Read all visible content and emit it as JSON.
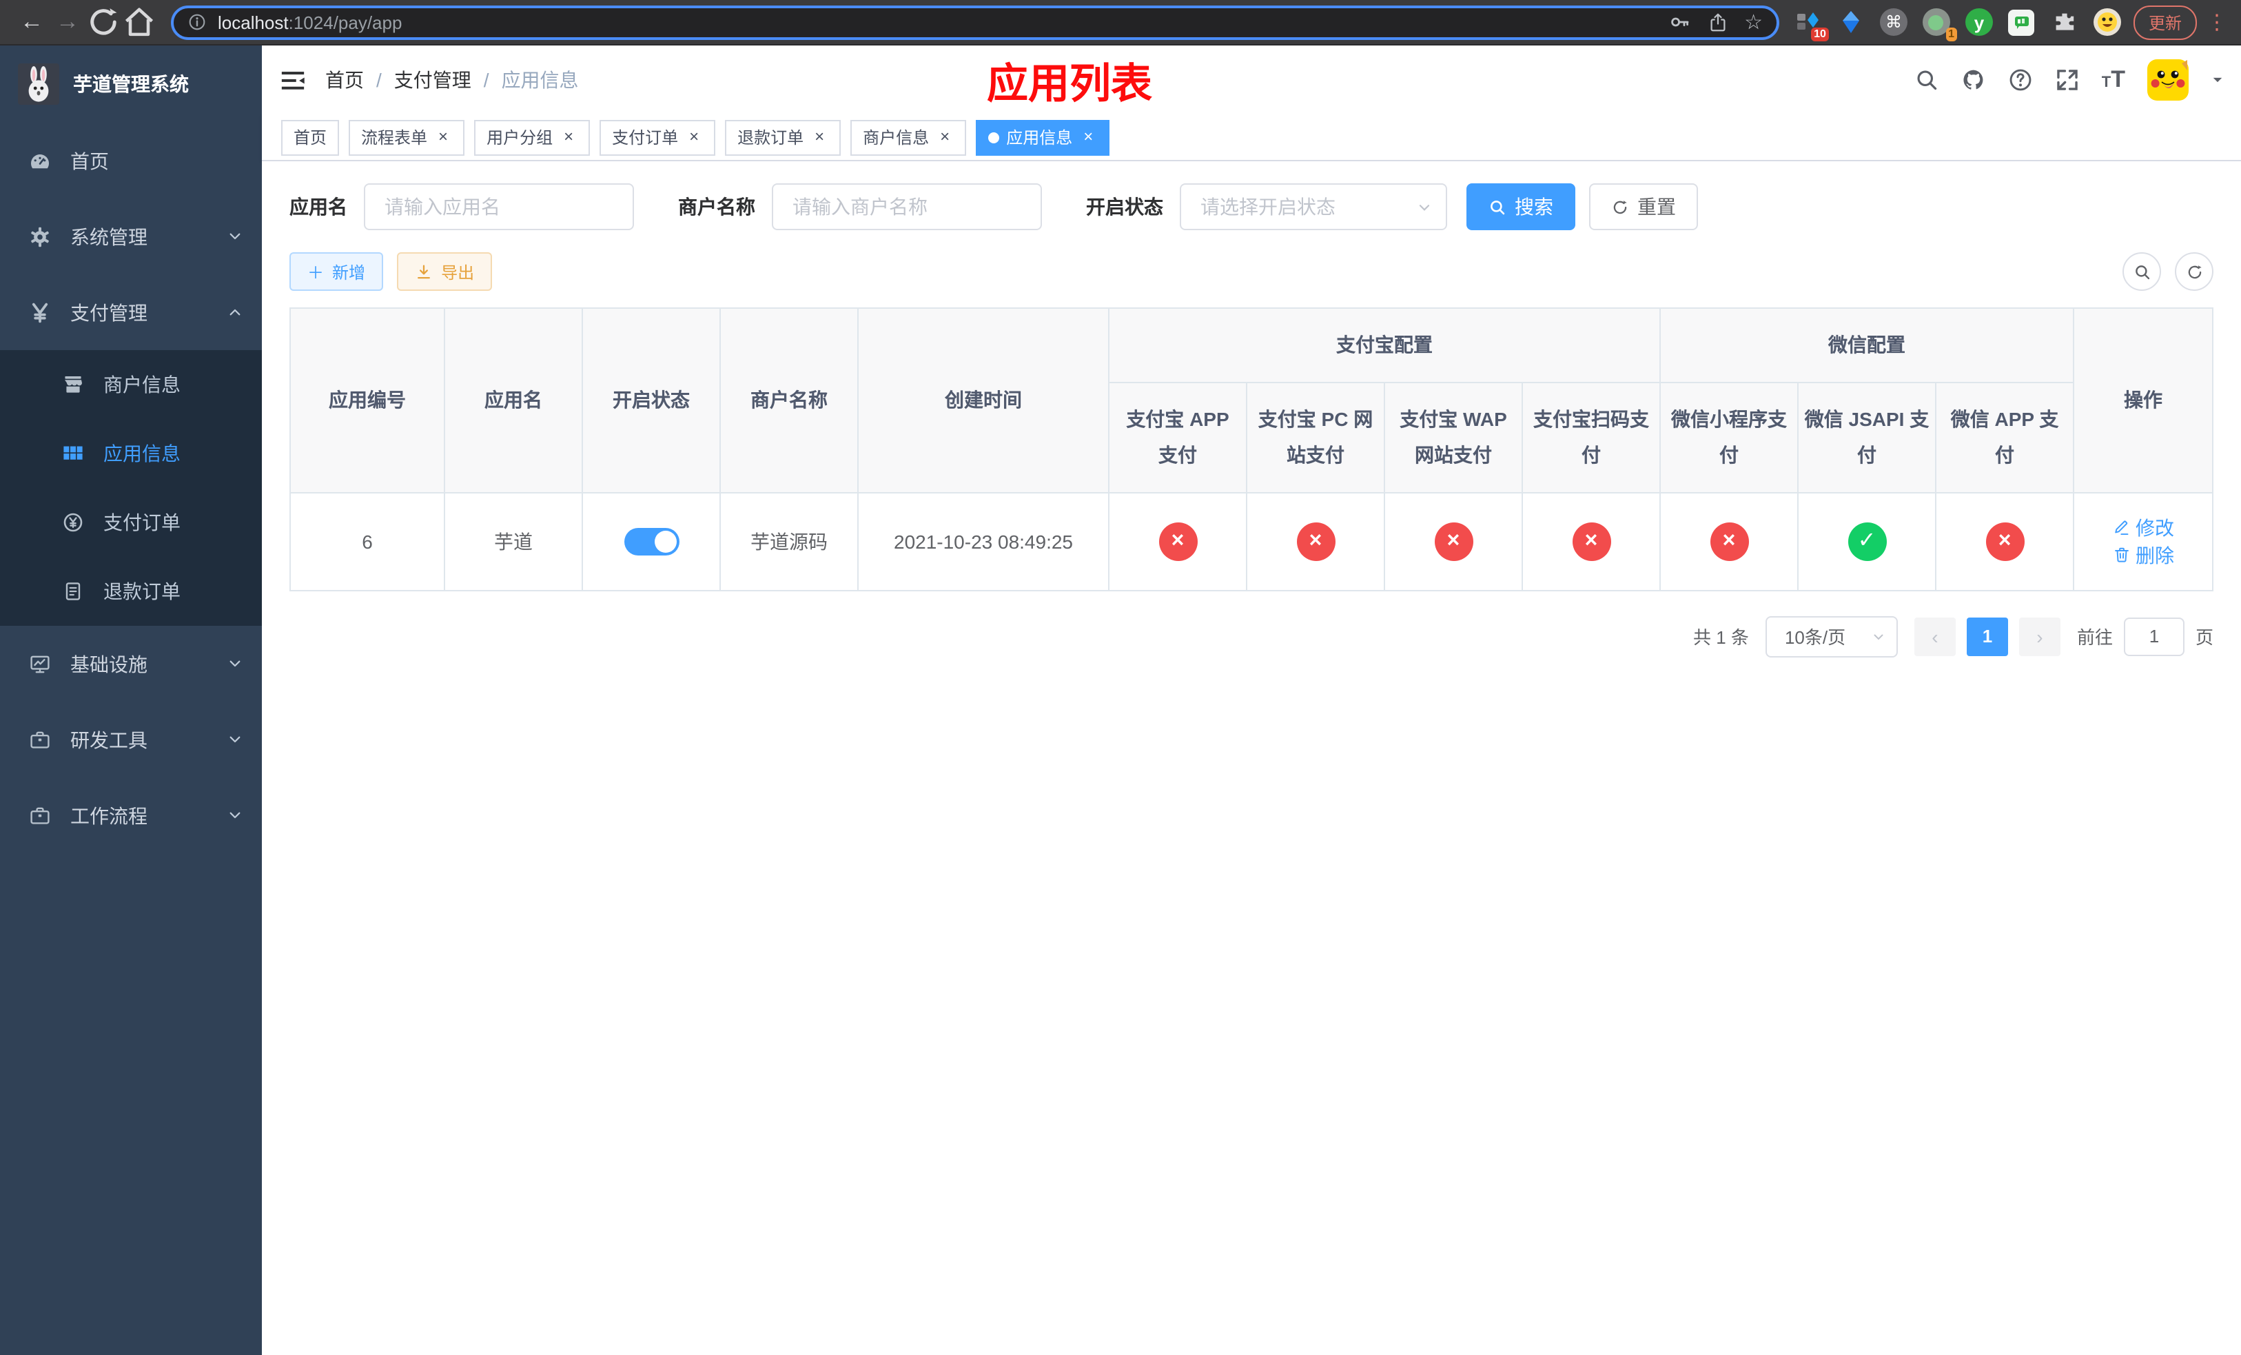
{
  "browser": {
    "url": {
      "host": "localhost",
      "path": ":1024/pay/app"
    },
    "badges": {
      "ext1": "10",
      "ext4": "1"
    },
    "update_button": "更新"
  },
  "sidebar": {
    "brand": "芋道管理系统",
    "menu": [
      {
        "label": "首页",
        "icon": "dashboard"
      },
      {
        "label": "系统管理",
        "icon": "gear",
        "expandable": true,
        "expanded": false
      },
      {
        "label": "支付管理",
        "icon": "yen",
        "expandable": true,
        "expanded": true,
        "children": [
          {
            "label": "商户信息",
            "icon": "shop"
          },
          {
            "label": "应用信息",
            "icon": "grid",
            "active": true
          },
          {
            "label": "支付订单",
            "icon": "coin"
          },
          {
            "label": "退款订单",
            "icon": "doc"
          }
        ]
      },
      {
        "label": "基础设施",
        "icon": "monitor",
        "expandable": true,
        "expanded": false
      },
      {
        "label": "研发工具",
        "icon": "briefcase",
        "expandable": true,
        "expanded": false
      },
      {
        "label": "工作流程",
        "icon": "briefcase",
        "expandable": true,
        "expanded": false
      }
    ]
  },
  "navbar": {
    "breadcrumb": [
      "首页",
      "支付管理",
      "应用信息"
    ],
    "page_title": "应用列表"
  },
  "tags": [
    {
      "label": "首页",
      "closable": false,
      "active": false
    },
    {
      "label": "流程表单",
      "closable": true,
      "active": false
    },
    {
      "label": "用户分组",
      "closable": true,
      "active": false
    },
    {
      "label": "支付订单",
      "closable": true,
      "active": false
    },
    {
      "label": "退款订单",
      "closable": true,
      "active": false
    },
    {
      "label": "商户信息",
      "closable": true,
      "active": false
    },
    {
      "label": "应用信息",
      "closable": true,
      "active": true
    }
  ],
  "filters": {
    "app_name": {
      "label": "应用名",
      "placeholder": "请输入应用名",
      "value": ""
    },
    "merchant_name": {
      "label": "商户名称",
      "placeholder": "请输入商户名称",
      "value": ""
    },
    "status": {
      "label": "开启状态",
      "placeholder": "请选择开启状态",
      "value": ""
    },
    "search_label": "搜索",
    "reset_label": "重置"
  },
  "toolbar": {
    "add_label": "新增",
    "export_label": "导出"
  },
  "table": {
    "group_headers": {
      "alipay": "支付宝配置",
      "wechat": "微信配置"
    },
    "columns": [
      "应用编号",
      "应用名",
      "开启状态",
      "商户名称",
      "创建时间",
      "支付宝 APP 支付",
      "支付宝 PC 网站支付",
      "支付宝 WAP 网站支付",
      "支付宝扫码支付",
      "微信小程序支付",
      "微信 JSAPI 支付",
      "微信 APP 支付",
      "操作"
    ],
    "rows": [
      {
        "id": "6",
        "name": "芋道",
        "enabled": true,
        "merchant": "芋道源码",
        "created_at": "2021-10-23 08:49:25",
        "channels": [
          "no",
          "no",
          "no",
          "no",
          "no",
          "yes",
          "no"
        ],
        "edit_label": "修改",
        "delete_label": "删除"
      }
    ]
  },
  "pagination": {
    "total": "共 1 条",
    "page_size": "10条/页",
    "current_page": "1",
    "goto_label": "前往",
    "goto_value": "1",
    "page_suffix": "页"
  },
  "colors": {
    "primary": "#409eff",
    "success": "#13ce66",
    "danger": "#f24c4c",
    "warning": "#e6a23c",
    "sidebar": "#304156"
  }
}
